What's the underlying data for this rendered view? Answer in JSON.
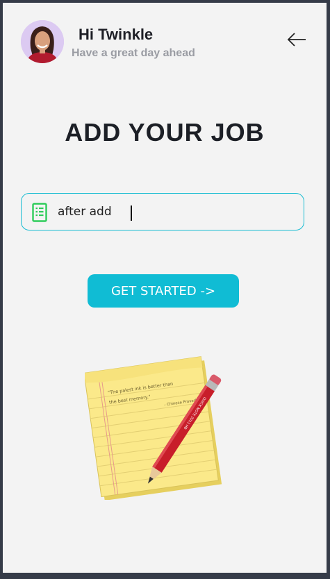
{
  "header": {
    "greeting": "Hi Twinkle",
    "subtitle": "Have a great day ahead"
  },
  "main": {
    "title": "ADD YOUR JOB",
    "job_input": {
      "value": "after add",
      "placeholder": ""
    },
    "start_button_label": "GET STARTED ->"
  },
  "illustration": {
    "note_quote": "\"The palest ink is better than",
    "note_quote_2": "the best memory.\"",
    "note_attribution": "- Chinese Proverb",
    "pencil_text": "QUICK NOTE  2011  HB"
  },
  "colors": {
    "accent": "#10bcd4",
    "icon_green": "#2ecc5a",
    "background": "#f3f3f3",
    "frame": "#353b48"
  },
  "icons": {
    "back": "arrow-left-icon",
    "field": "document-list-icon"
  }
}
